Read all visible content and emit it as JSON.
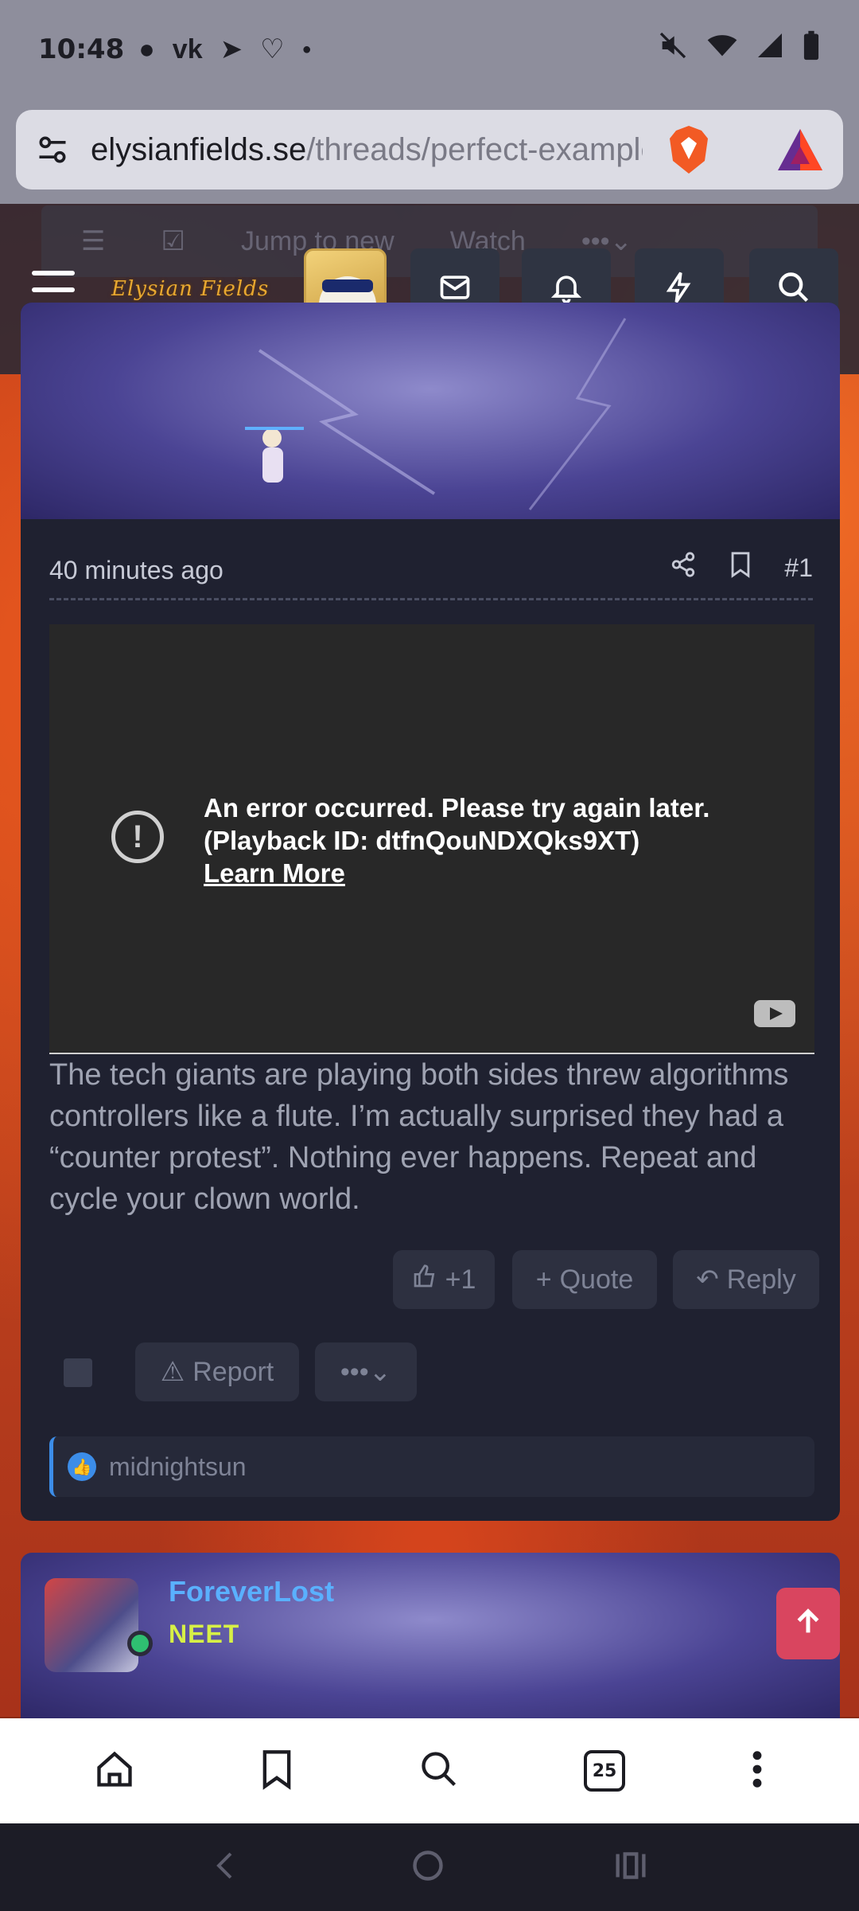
{
  "status_bar": {
    "time": "10:48"
  },
  "browser": {
    "url_domain": "elysianfields.se",
    "url_path": "/threads/perfect-example",
    "tab_count": "25"
  },
  "forum": {
    "logo_text": "Elysian Fields",
    "ghost_tabs": [
      "Jump to new",
      "Watch"
    ]
  },
  "post": {
    "time": "40 minutes ago",
    "post_number": "#1",
    "video_error": {
      "line1": "An error occurred. Please try again later.",
      "line2": "(Playback ID: dtfnQouNDXQks9XT)",
      "learn_more": "Learn More"
    },
    "body": "The tech giants are playing both sides threw algorithms controllers like a flute. I’m actually surprised they had a “counter protest”. Nothing ever happens. Repeat and cycle your clown world.",
    "actions": {
      "like": "+1",
      "quote": "Quote",
      "reply": "Reply",
      "report": "Report"
    },
    "reactions": {
      "user": "midnightsun"
    }
  },
  "next_post": {
    "username": "ForeverLost",
    "role": "NEET"
  },
  "colors": {
    "accent": "#3c8de8",
    "username": "#5ab0ff",
    "role": "#d7f046",
    "online": "#2fbf71",
    "scroll_top": "#d9455f"
  }
}
